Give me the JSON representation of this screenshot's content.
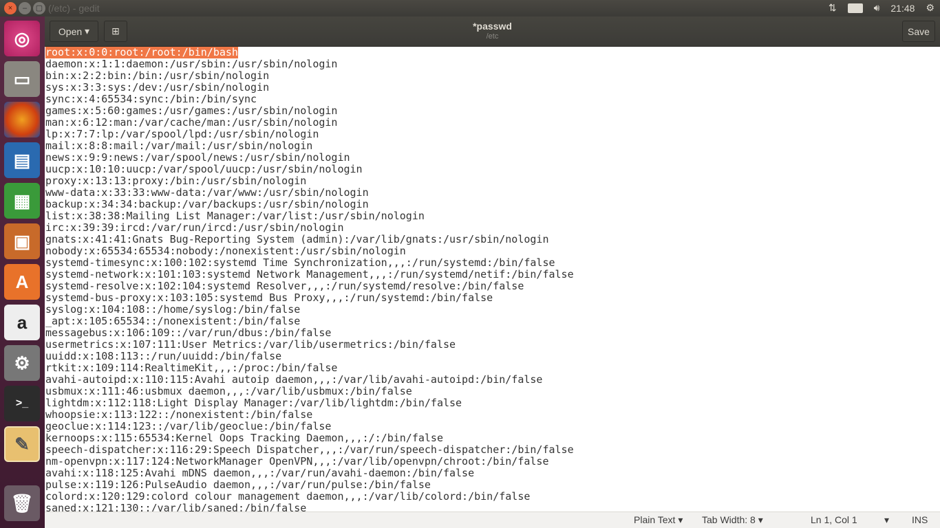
{
  "window": {
    "title": "(/etc) - gedit",
    "buttons": [
      "×",
      "–",
      "▢"
    ]
  },
  "panel": {
    "clock": "21:48",
    "icons": [
      "network-icon",
      "keyboard-icon",
      "volume-icon",
      "power-gear-icon"
    ]
  },
  "launcher": [
    "ubuntu-dash",
    "files",
    "firefox",
    "libreoffice-writer",
    "libreoffice-calc",
    "libreoffice-impress",
    "software-center",
    "amazon",
    "system-settings",
    "terminal",
    "gedit",
    "trash"
  ],
  "header": {
    "open_label": "Open",
    "doc_title": "*passwd",
    "doc_path": "/etc",
    "save_label": "Save"
  },
  "editor": {
    "selection_color": "#f07746",
    "lines": [
      "root:x:0:0:root:/root:/bin/bash",
      "daemon:x:1:1:daemon:/usr/sbin:/usr/sbin/nologin",
      "bin:x:2:2:bin:/bin:/usr/sbin/nologin",
      "sys:x:3:3:sys:/dev:/usr/sbin/nologin",
      "sync:x:4:65534:sync:/bin:/bin/sync",
      "games:x:5:60:games:/usr/games:/usr/sbin/nologin",
      "man:x:6:12:man:/var/cache/man:/usr/sbin/nologin",
      "lp:x:7:7:lp:/var/spool/lpd:/usr/sbin/nologin",
      "mail:x:8:8:mail:/var/mail:/usr/sbin/nologin",
      "news:x:9:9:news:/var/spool/news:/usr/sbin/nologin",
      "uucp:x:10:10:uucp:/var/spool/uucp:/usr/sbin/nologin",
      "proxy:x:13:13:proxy:/bin:/usr/sbin/nologin",
      "www-data:x:33:33:www-data:/var/www:/usr/sbin/nologin",
      "backup:x:34:34:backup:/var/backups:/usr/sbin/nologin",
      "list:x:38:38:Mailing List Manager:/var/list:/usr/sbin/nologin",
      "irc:x:39:39:ircd:/var/run/ircd:/usr/sbin/nologin",
      "gnats:x:41:41:Gnats Bug-Reporting System (admin):/var/lib/gnats:/usr/sbin/nologin",
      "nobody:x:65534:65534:nobody:/nonexistent:/usr/sbin/nologin",
      "systemd-timesync:x:100:102:systemd Time Synchronization,,,:/run/systemd:/bin/false",
      "systemd-network:x:101:103:systemd Network Management,,,:/run/systemd/netif:/bin/false",
      "systemd-resolve:x:102:104:systemd Resolver,,,:/run/systemd/resolve:/bin/false",
      "systemd-bus-proxy:x:103:105:systemd Bus Proxy,,,:/run/systemd:/bin/false",
      "syslog:x:104:108::/home/syslog:/bin/false",
      "_apt:x:105:65534::/nonexistent:/bin/false",
      "messagebus:x:106:109::/var/run/dbus:/bin/false",
      "usermetrics:x:107:111:User Metrics:/var/lib/usermetrics:/bin/false",
      "uuidd:x:108:113::/run/uuidd:/bin/false",
      "rtkit:x:109:114:RealtimeKit,,,:/proc:/bin/false",
      "avahi-autoipd:x:110:115:Avahi autoip daemon,,,:/var/lib/avahi-autoipd:/bin/false",
      "usbmux:x:111:46:usbmux daemon,,,:/var/lib/usbmux:/bin/false",
      "lightdm:x:112:118:Light Display Manager:/var/lib/lightdm:/bin/false",
      "whoopsie:x:113:122::/nonexistent:/bin/false",
      "geoclue:x:114:123::/var/lib/geoclue:/bin/false",
      "kernoops:x:115:65534:Kernel Oops Tracking Daemon,,,:/:/bin/false",
      "speech-dispatcher:x:116:29:Speech Dispatcher,,,:/var/run/speech-dispatcher:/bin/false",
      "nm-openvpn:x:117:124:NetworkManager OpenVPN,,,:/var/lib/openvpn/chroot:/bin/false",
      "avahi:x:118:125:Avahi mDNS daemon,,,:/var/run/avahi-daemon:/bin/false",
      "pulse:x:119:126:PulseAudio daemon,,,:/var/run/pulse:/bin/false",
      "colord:x:120:129:colord colour management daemon,,,:/var/lib/colord:/bin/false",
      "saned:x:121:130::/var/lib/saned:/bin/false"
    ]
  },
  "statusbar": {
    "language": "Plain Text",
    "tab_width": "Tab Width: 8",
    "position": "Ln 1, Col 1",
    "mode": "INS"
  }
}
